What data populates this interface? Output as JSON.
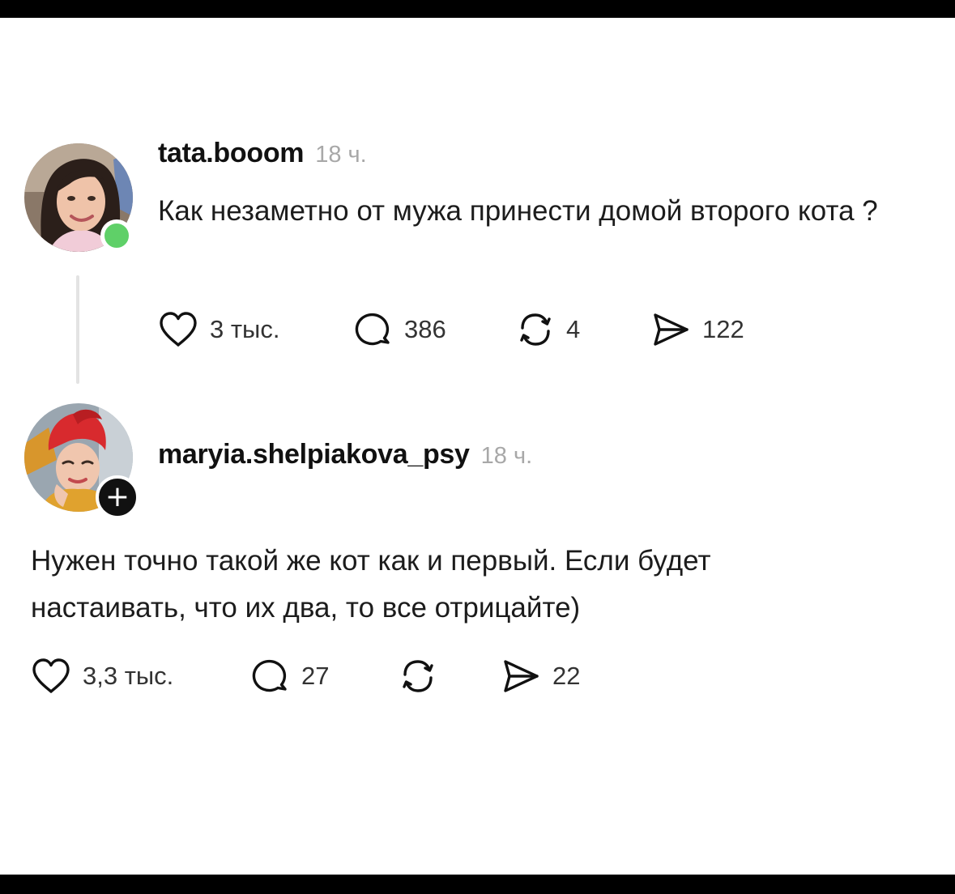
{
  "post": {
    "username": "tata.booom",
    "time": "18 ч.",
    "text": "Как незаметно от мужа принести домой второго кота ?",
    "likes": "3 тыс.",
    "comments": "386",
    "reposts": "4",
    "shares": "122",
    "online": true
  },
  "reply": {
    "username": "maryia.shelpiakova_psy",
    "time": "18 ч.",
    "text": "Нужен точно такой же кот как и первый. Если будет настаивать, что их два, то все отрицайте)",
    "likes": "3,3 тыс.",
    "comments": "27",
    "reposts": "",
    "shares": "22",
    "follow_symbol": "+"
  },
  "colors": {
    "online": "#5fd068",
    "timestamp": "#a8a8a8",
    "thread_line": "#e3e3e3"
  },
  "icons": [
    "heart-icon",
    "comment-bubble-icon",
    "repost-icon",
    "share-send-icon",
    "follow-plus-icon"
  ]
}
